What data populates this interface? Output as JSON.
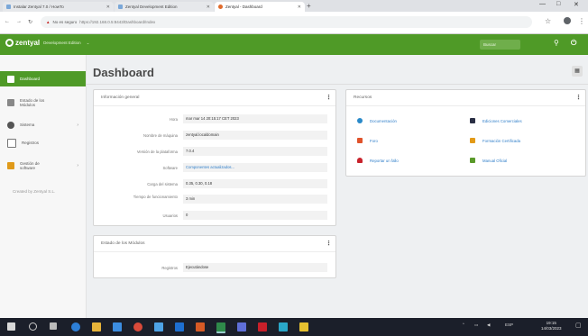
{
  "browser": {
    "tabs": [
      {
        "label": "Instalar Zentyal 7.0 / HowTo"
      },
      {
        "label": "Zentyal Development Edition"
      },
      {
        "label": "Zentyal - Dashboard"
      }
    ],
    "new_tab": "+",
    "window_controls": {
      "minimize": "—",
      "maximize": "□",
      "close": "✕"
    },
    "nav": {
      "back": "←",
      "forward": "→",
      "reload": "↻"
    },
    "security_label": "No es seguro",
    "url": "https://192.168.0.5:8443/Dashboard/Index",
    "star": "☆",
    "menu": "⋮"
  },
  "app": {
    "logo_text": "zentyal",
    "edition": "Development Edition",
    "search_placeholder": "Buscar",
    "brand_color": "#4f9a27"
  },
  "sidebar": {
    "items": [
      {
        "label": "Dashboard",
        "icon": "home-icon",
        "active": true
      },
      {
        "label": "Estado de los Módulos",
        "icon": "modules-icon",
        "active": false
      },
      {
        "label": "Sistema",
        "icon": "gear-icon",
        "active": false,
        "has_children": true
      },
      {
        "label": "Registros",
        "icon": "document-icon",
        "active": false
      },
      {
        "label": "Gestión de software",
        "icon": "package-icon",
        "active": false,
        "has_children": true
      }
    ],
    "footer": "Created by Zentyal S.L."
  },
  "page": {
    "title": "Dashboard"
  },
  "general_info": {
    "title": "Información general",
    "rows": [
      {
        "label": "Hora",
        "value": "mar mar 14 20:15:17 CET 2023"
      },
      {
        "label": "Nombre de máquina",
        "value": "zentyal.localdomain"
      },
      {
        "label": "Versión de la plataforma",
        "value": "7.0.4"
      },
      {
        "label": "Software",
        "value": "Componentes actualizados..."
      },
      {
        "label": "Carga del sistema",
        "value": "0.35, 0.30, 0.18"
      },
      {
        "label": "Tiempo de funcionamiento",
        "value": "3 min"
      },
      {
        "label": "Usuarios",
        "value": "0"
      }
    ]
  },
  "module_status": {
    "title": "Estado de los Módulos",
    "rows": [
      {
        "label": "Registros",
        "value": "Ejecutándose"
      }
    ]
  },
  "resources": {
    "title": "Recursos",
    "items": [
      {
        "label": "Documentación",
        "icon": "book-icon",
        "color": "#2a8ac9"
      },
      {
        "label": "Foro",
        "icon": "forum-icon",
        "color": "#e0532b"
      },
      {
        "label": "Reportar un fallo",
        "icon": "bug-icon",
        "color": "#c8232c"
      },
      {
        "label": "Ediciones Comerciales",
        "icon": "briefcase-icon",
        "color": "#2a2f44"
      },
      {
        "label": "Formación Certificada",
        "icon": "trophy-icon",
        "color": "#e39a18"
      },
      {
        "label": "Manual Oficial",
        "icon": "manual-icon",
        "color": "#5a9a2a"
      }
    ]
  },
  "taskbar": {
    "tray_text": "ESP",
    "time": "19:15",
    "date": "14/03/2023"
  }
}
